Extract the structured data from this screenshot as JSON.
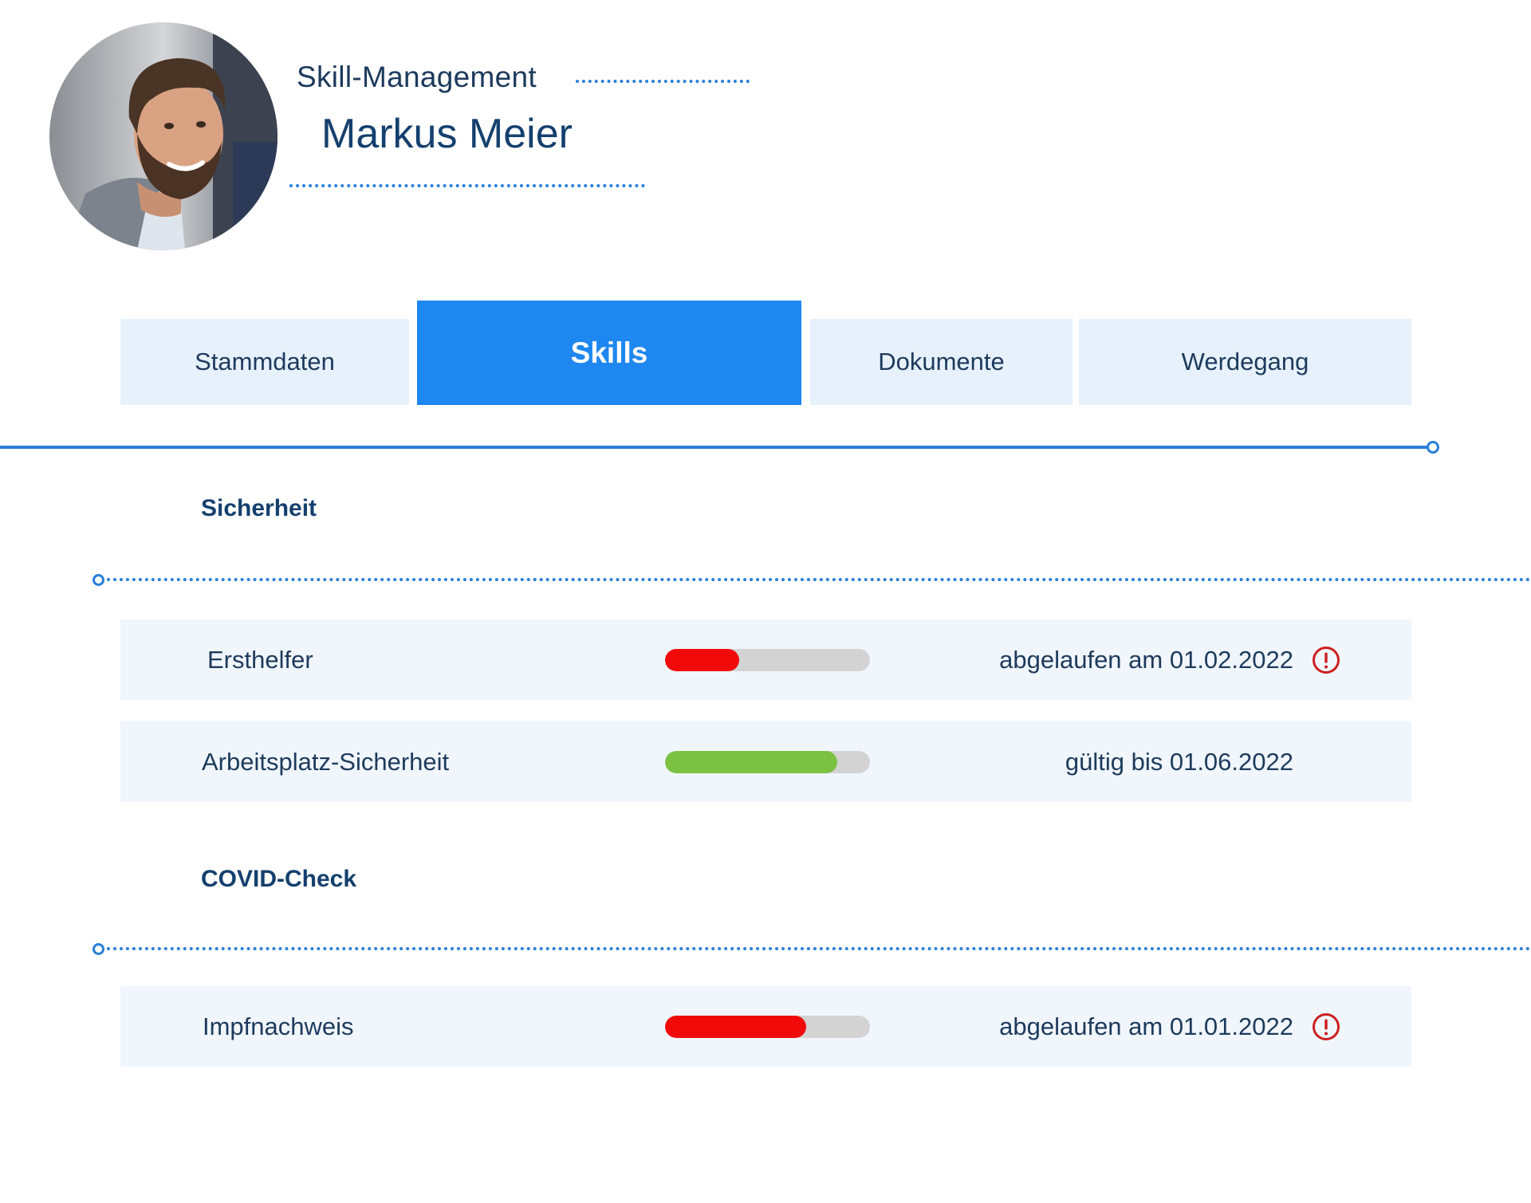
{
  "header": {
    "app_label": "Skill-Management",
    "person_name": "Markus Meier"
  },
  "tabs": [
    {
      "label": "Stammdaten",
      "active": false
    },
    {
      "label": "Skills",
      "active": true
    },
    {
      "label": "Dokumente",
      "active": false
    },
    {
      "label": "Werdegang",
      "active": false
    }
  ],
  "sections": [
    {
      "title": "Sicherheit",
      "skills": [
        {
          "name": "Ersthelfer",
          "progress": 0.36,
          "status_text": "abgelaufen am 01.02.2022",
          "state": "expired",
          "warning_icon": "exclamation-circle-icon"
        },
        {
          "name": "Arbeitsplatz-Sicherheit",
          "progress": 0.84,
          "status_text": "gültig bis 01.06.2022",
          "state": "valid"
        }
      ]
    },
    {
      "title": "COVID-Check",
      "skills": [
        {
          "name": "Impfnachweis",
          "progress": 0.69,
          "status_text": "abgelaufen am 01.01.2022",
          "state": "expired",
          "warning_icon": "exclamation-circle-icon"
        }
      ]
    }
  ],
  "colors": {
    "accent": "#1e87f0",
    "line": "#2a7fd9",
    "text": "#1d3a5c",
    "tab_bg": "#e6f1fc",
    "row_bg": "#f0f6fc",
    "expired": "#f00a0a",
    "valid": "#7cc242",
    "track": "#d3d3d3",
    "warning": "#cc1f1f"
  }
}
